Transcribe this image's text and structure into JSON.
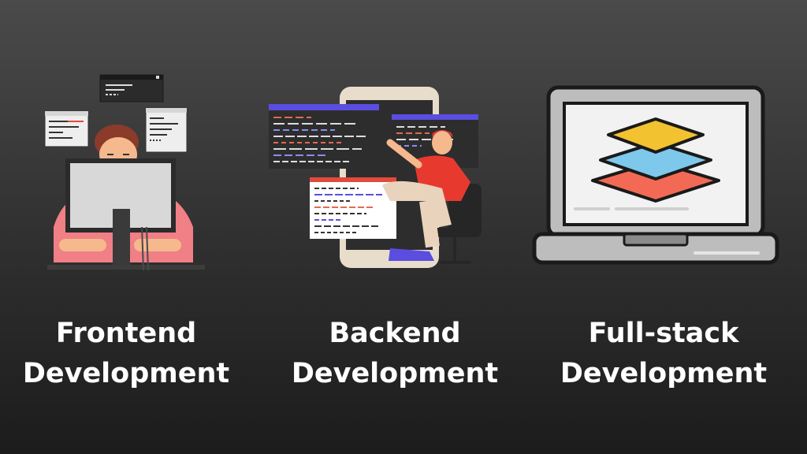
{
  "columns": [
    {
      "title_line1": "Frontend",
      "title_line2": "Development",
      "icon": "frontend-developer-illustration"
    },
    {
      "title_line1": "Backend",
      "title_line2": "Development",
      "icon": "backend-developer-illustration"
    },
    {
      "title_line1": "Full-stack",
      "title_line2": "Development",
      "icon": "fullstack-layers-laptop-illustration"
    }
  ],
  "colors": {
    "background_top": "#4a4a4a",
    "background_bottom": "#1c1c1c",
    "caption": "#ffffff",
    "layer_yellow": "#f2c230",
    "layer_blue": "#7ec8ec",
    "layer_red": "#f26a55",
    "accent_purple": "#5b4de0",
    "shirt_red": "#e8392f"
  }
}
